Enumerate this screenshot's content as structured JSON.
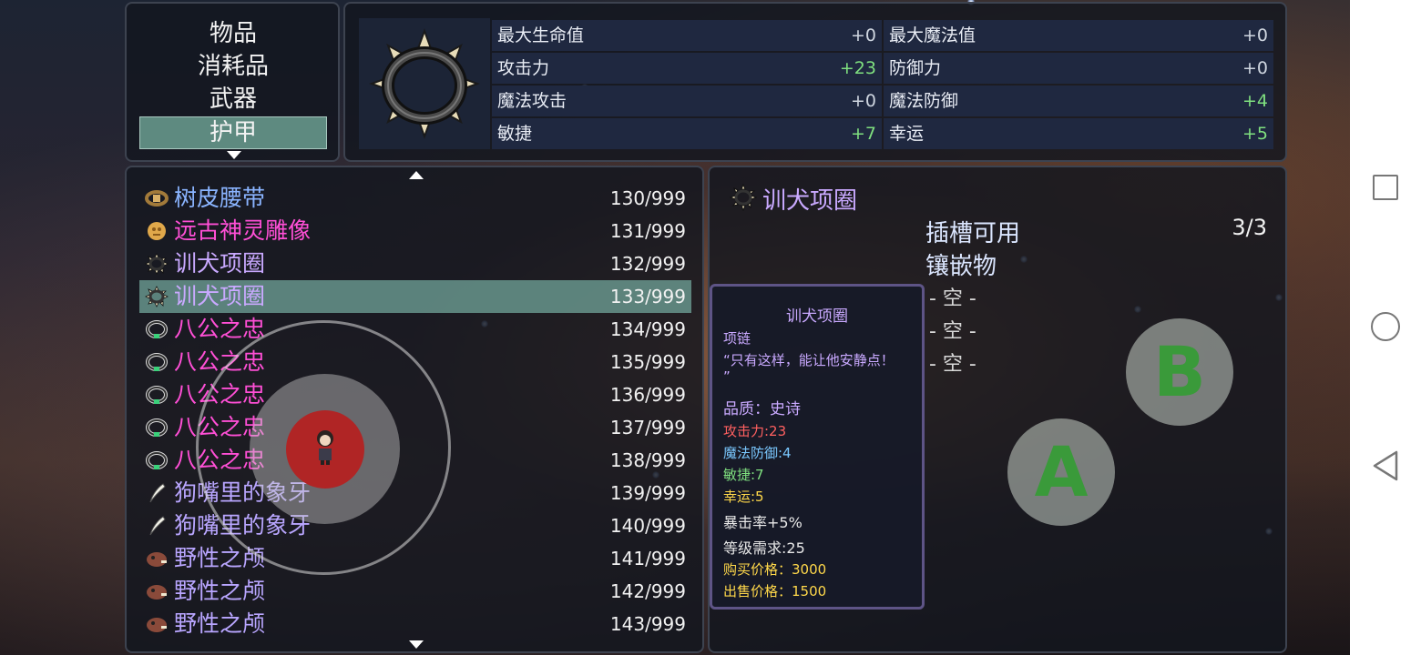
{
  "categories": {
    "items": [
      "物品",
      "消耗品",
      "武器",
      "护甲"
    ],
    "selected_index": 3
  },
  "stats": {
    "left": [
      {
        "label": "最大生命值",
        "value": "+0",
        "positive": false
      },
      {
        "label": "攻击力",
        "value": "+23",
        "positive": true
      },
      {
        "label": "魔法攻击",
        "value": "+0",
        "positive": false
      },
      {
        "label": "敏捷",
        "value": "+7",
        "positive": true
      }
    ],
    "right": [
      {
        "label": "最大魔法值",
        "value": "+0",
        "positive": false
      },
      {
        "label": "防御力",
        "value": "+0",
        "positive": false
      },
      {
        "label": "魔法防御",
        "value": "+4",
        "positive": true
      },
      {
        "label": "幸运",
        "value": "+5",
        "positive": true
      }
    ]
  },
  "inventory": {
    "selected_index": 3,
    "rows": [
      {
        "name": "树皮腰带",
        "qty": "130/999",
        "color": "blue",
        "icon": "belt-icon"
      },
      {
        "name": "远古神灵雕像",
        "qty": "131/999",
        "color": "pink",
        "icon": "statue-icon"
      },
      {
        "name": "训犬项圈",
        "qty": "132/999",
        "color": "purple",
        "icon": "spiked-collar-icon"
      },
      {
        "name": "训犬项圈",
        "qty": "133/999",
        "color": "purple",
        "icon": "spiked-collar-icon"
      },
      {
        "name": "八公之忠",
        "qty": "134/999",
        "color": "pink",
        "icon": "gem-collar-icon"
      },
      {
        "name": "八公之忠",
        "qty": "135/999",
        "color": "pink",
        "icon": "gem-collar-icon"
      },
      {
        "name": "八公之忠",
        "qty": "136/999",
        "color": "pink",
        "icon": "gem-collar-icon"
      },
      {
        "name": "八公之忠",
        "qty": "137/999",
        "color": "pink",
        "icon": "gem-collar-icon"
      },
      {
        "name": "八公之忠",
        "qty": "138/999",
        "color": "pink",
        "icon": "gem-collar-icon"
      },
      {
        "name": "狗嘴里的象牙",
        "qty": "139/999",
        "color": "lav",
        "icon": "tusk-icon"
      },
      {
        "name": "狗嘴里的象牙",
        "qty": "140/999",
        "color": "lav",
        "icon": "tusk-icon"
      },
      {
        "name": "野性之颅",
        "qty": "141/999",
        "color": "lav",
        "icon": "boar-skull-icon"
      },
      {
        "name": "野性之颅",
        "qty": "142/999",
        "color": "lav",
        "icon": "boar-skull-icon"
      },
      {
        "name": "野性之颅",
        "qty": "143/999",
        "color": "lav",
        "icon": "boar-skull-icon"
      }
    ]
  },
  "detail": {
    "item_name": "训犬项圈",
    "slots_label": "插槽可用",
    "slots_value": "3/3",
    "inlay_label": "镶嵌物",
    "slots": [
      "- 空 -",
      "- 空 -",
      "- 空 -"
    ]
  },
  "tooltip": {
    "title": "训犬项圈",
    "type": "项链",
    "quote_line1": "“只有这样，能让他安静点！",
    "quote_line2": "”",
    "quality": "品质：史诗",
    "attack": "攻击力:23",
    "magic_def": "魔法防御:4",
    "agility": "敏捷:7",
    "luck": "幸运:5",
    "crit": "暴击率+5%",
    "level_req": "等级需求:25",
    "buy_price": "购买价格：3000",
    "sell_price": "出售价格：1500"
  },
  "controls": {
    "button_a": "A",
    "button_b": "B"
  },
  "colors": {
    "selected_row": "#5e8a80",
    "positive_stat": "#7fe07f",
    "blue_item": "#8ab4ff",
    "pink_item": "#ff4fd6",
    "purple_item": "#c9a9ff",
    "tooltip_border": "#5e5486"
  },
  "system_nav": {
    "recent_icon": "square-icon",
    "home_icon": "circle-icon",
    "back_icon": "triangle-back-icon"
  }
}
